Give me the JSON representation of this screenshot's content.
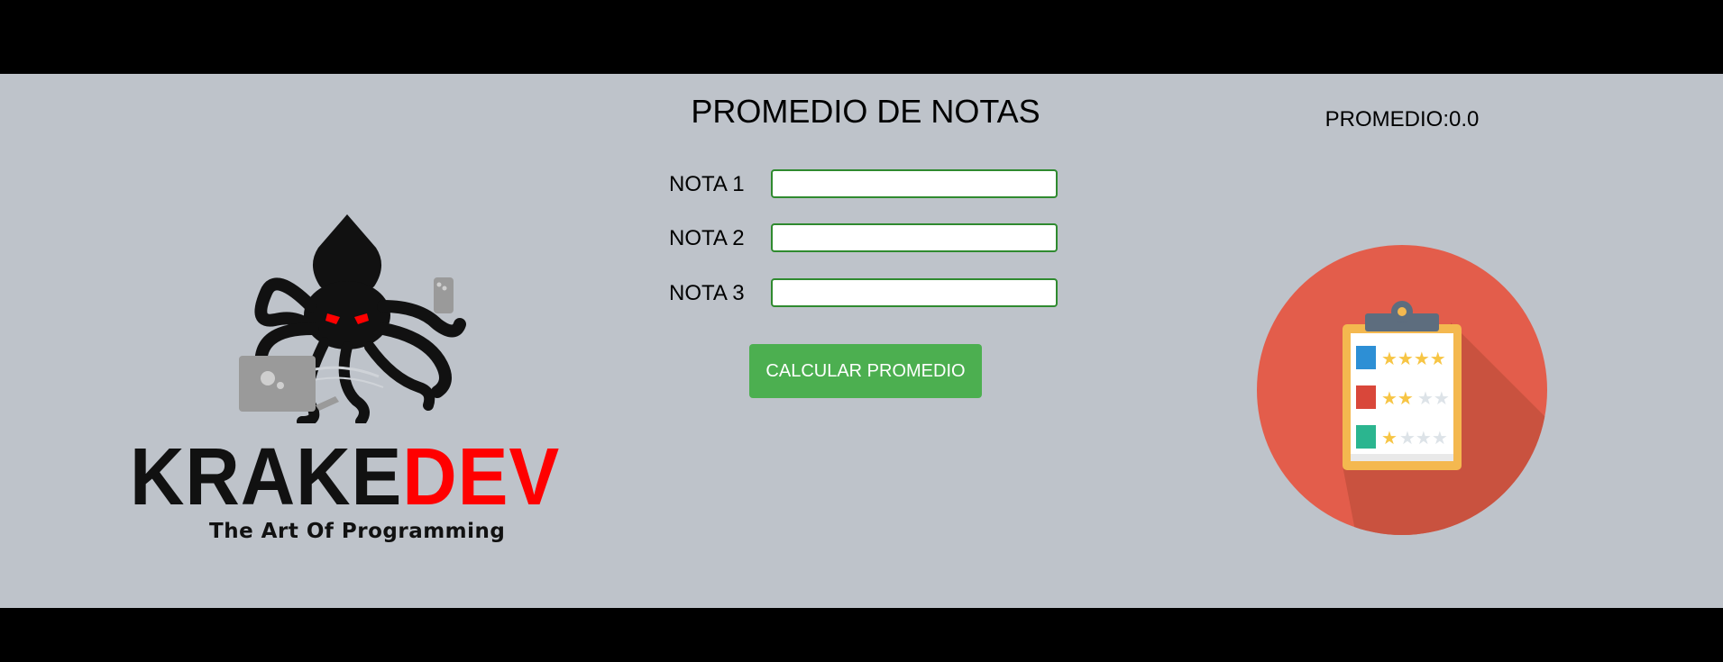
{
  "brand": {
    "name_part1": "KRAKE",
    "name_part2": "DEV",
    "tagline": "The Art Of Programming",
    "accent_color": "#ff0000"
  },
  "form": {
    "title": "PROMEDIO DE NOTAS",
    "fields": [
      {
        "label": "NOTA 1",
        "value": "",
        "placeholder": ""
      },
      {
        "label": "NOTA 2",
        "value": "",
        "placeholder": ""
      },
      {
        "label": "NOTA 3",
        "value": "",
        "placeholder": ""
      }
    ],
    "button_label": "CALCULAR PROMEDIO",
    "button_color": "#4caf50"
  },
  "result": {
    "label": "PROMEDIO:",
    "value": "0.0"
  },
  "icons": {
    "logo": "kraken-octopus-logo",
    "illustration": "clipboard-rating-icon"
  },
  "theme": {
    "background": "#bec3ca",
    "bars": "#000000"
  }
}
